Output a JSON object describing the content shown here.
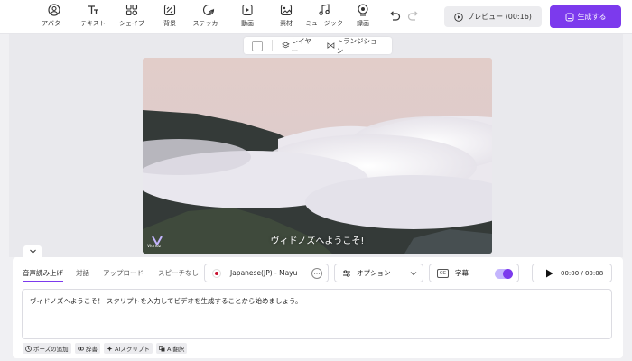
{
  "toolbar": {
    "tools": [
      {
        "label": "アバター",
        "icon": "avatar-icon"
      },
      {
        "label": "テキスト",
        "icon": "text-icon"
      },
      {
        "label": "シェイプ",
        "icon": "shape-icon"
      },
      {
        "label": "背景",
        "icon": "background-icon"
      },
      {
        "label": "ステッカー",
        "icon": "sticker-icon"
      },
      {
        "label": "動画",
        "icon": "video-icon"
      },
      {
        "label": "素材",
        "icon": "media-icon"
      },
      {
        "label": "ミュージック",
        "icon": "music-icon"
      },
      {
        "label": "録画",
        "icon": "record-icon"
      }
    ],
    "preview_label": "プレビュー (00:16)",
    "generate_label": "生成する"
  },
  "layer_bar": {
    "layer_label": "レイヤー",
    "transition_label": "トランジション"
  },
  "video": {
    "subtitle": "ヴィドノズへようこそ!",
    "watermark_text": "Vidnoz"
  },
  "panel": {
    "tabs": [
      "音声読み上げ",
      "対話",
      "アップロード",
      "スピーチなし"
    ],
    "active_tab": 0,
    "voice": "Japanese(JP) - Mayu",
    "voice_more": "…",
    "option_label": "オプション",
    "caption_badge": "CC",
    "caption_label": "字幕",
    "caption_on": true,
    "time": "00:00 / 00:08",
    "script_text": "ヴィドノズへようこそ！ スクリプトを入力してビデオを生成することから始めましょう。",
    "chips": [
      {
        "label": "ポーズの追加",
        "icon": "clock-icon"
      },
      {
        "label": "辞書",
        "icon": "dictionary-icon"
      },
      {
        "label": "AIスクリプト",
        "icon": "ai-script-icon"
      },
      {
        "label": "AI翻訳",
        "icon": "translate-icon"
      }
    ]
  },
  "colors": {
    "accent": "#7c3aed",
    "toggle_track": "#c4b5fd",
    "background": "#f0f0f3"
  }
}
